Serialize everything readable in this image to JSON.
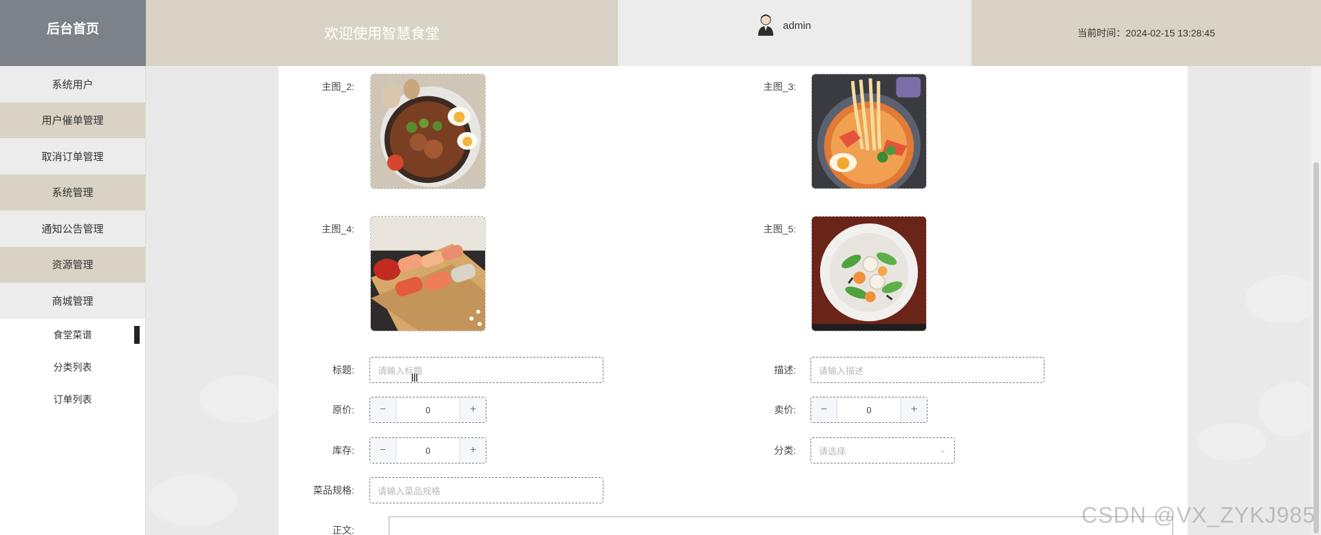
{
  "header": {
    "brand": "后台首页",
    "welcome": "欢迎使用智慧食堂",
    "username": "admin",
    "time_label": "当前时间：2024-02-15 13:28:45"
  },
  "sidebar": {
    "items": [
      {
        "label": "系统用户"
      },
      {
        "label": "用户催单管理"
      },
      {
        "label": "取消订单管理"
      },
      {
        "label": "系统管理"
      },
      {
        "label": "通知公告管理"
      },
      {
        "label": "资源管理"
      },
      {
        "label": "商城管理"
      }
    ],
    "sub_items": [
      {
        "label": "食堂菜谱",
        "active": true
      },
      {
        "label": "分类列表"
      },
      {
        "label": "订单列表"
      }
    ]
  },
  "form": {
    "img2_label": "主图_2:",
    "img3_label": "主图_3:",
    "img4_label": "主图_4:",
    "img5_label": "主图_5:",
    "title_label": "标题:",
    "title_placeholder": "请输入标题",
    "desc_label": "描述:",
    "desc_placeholder": "请输入描述",
    "orig_price_label": "原价:",
    "orig_price_value": "0",
    "sale_price_label": "卖价:",
    "sale_price_value": "0",
    "stock_label": "库存:",
    "stock_value": "0",
    "category_label": "分类:",
    "category_placeholder": "请选择",
    "spec_label": "菜品规格:",
    "spec_placeholder": "请输入菜品规格",
    "body_label": "正文:",
    "minus": "−",
    "plus": "+"
  },
  "watermark": "CSDN @VX_ZYKJ985"
}
